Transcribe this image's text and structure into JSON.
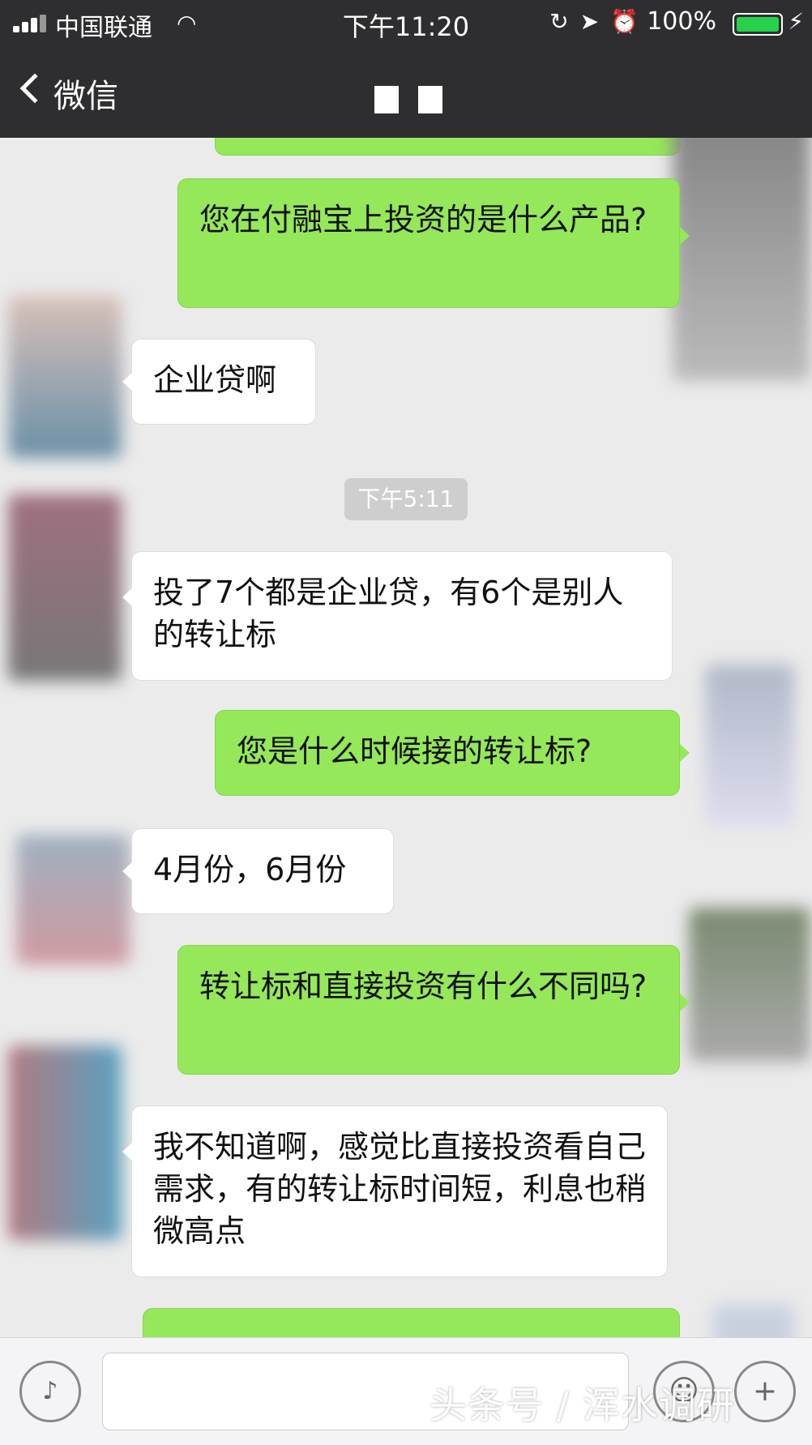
{
  "status_bar": {
    "carrier": "中国联通",
    "time": "下午11:20",
    "battery": "100%",
    "icons": [
      "wifi-icon",
      "rotation-lock-icon",
      "location-icon",
      "alarm-icon",
      "charging-icon"
    ]
  },
  "nav": {
    "back_label": "微信"
  },
  "chat": {
    "messages": [
      {
        "side": "right",
        "text": "您在付融宝上投资的是什么产品?"
      },
      {
        "side": "left",
        "text": "企业贷啊"
      },
      {
        "side": "left",
        "text": "投了7个都是企业贷，有6个是别人的转让标"
      },
      {
        "side": "right",
        "text": "您是什么时候接的转让标?"
      },
      {
        "side": "left",
        "text": "4月份，6月份"
      },
      {
        "side": "right",
        "text": "转让标和直接投资有什么不同吗?"
      },
      {
        "side": "left",
        "text": "我不知道啊，感觉比直接投资看自己需求，有的转让标时间短，利息也稍微高点"
      }
    ],
    "timestamp": "下午5:11"
  },
  "input_bar": {
    "icons": [
      "voice-icon",
      "emoji-icon",
      "plus-icon"
    ]
  },
  "watermark": "头条号 / 浑水调研",
  "colors": {
    "nav_bg": "#2e2e30",
    "chat_bg": "#ebebeb",
    "bubble_right": "#95e859",
    "bubble_left": "#ffffff",
    "battery": "#27d24b"
  }
}
